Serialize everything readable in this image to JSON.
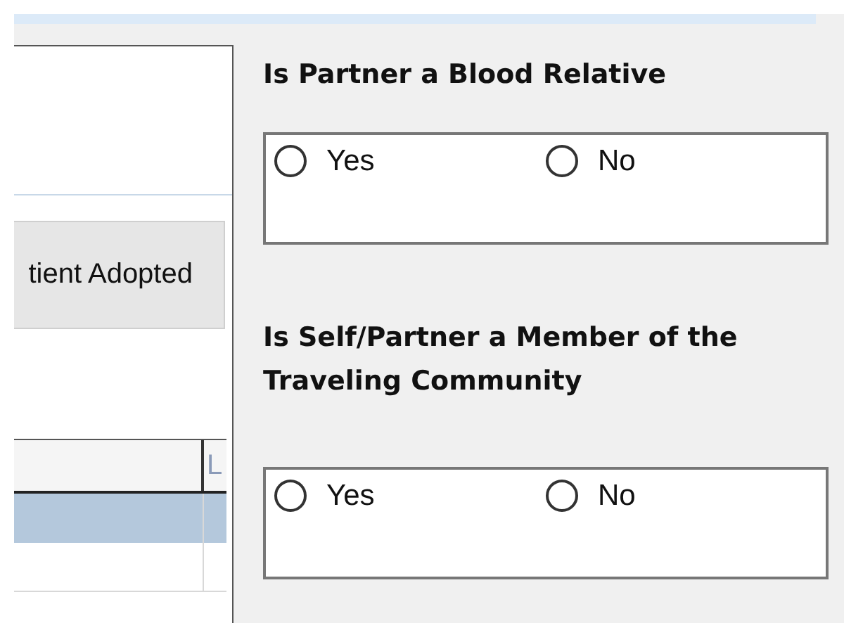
{
  "left_pane": {
    "button": "tient Adopted",
    "table": {
      "column_2": "L",
      "rows": [
        {
          "selected": true
        },
        {
          "selected": false
        }
      ]
    }
  },
  "questions": [
    {
      "title": "Is Partner a Blood Relative",
      "options": [
        {
          "label": "Yes",
          "selected": false
        },
        {
          "label": "No",
          "selected": false
        }
      ]
    },
    {
      "title": "Is Self/Partner a Member of the Traveling Community",
      "options": [
        {
          "label": "Yes",
          "selected": false
        },
        {
          "label": "No",
          "selected": false
        }
      ]
    }
  ]
}
